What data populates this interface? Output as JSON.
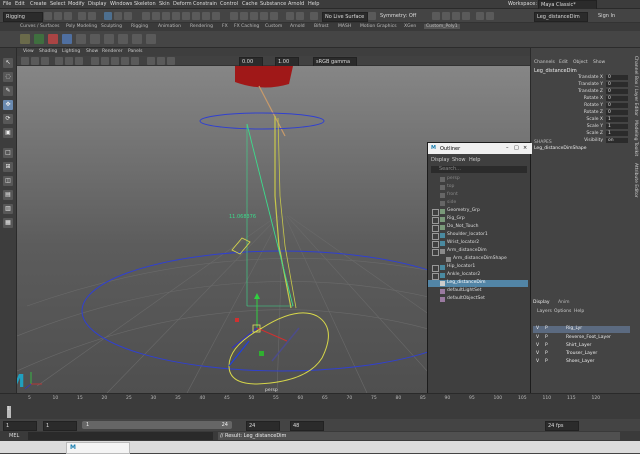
{
  "menubar": {
    "items": [
      "File",
      "Edit",
      "Create",
      "Select",
      "Modify",
      "Display",
      "Windows",
      "Skeleton",
      "Skin",
      "Deform",
      "Constrain",
      "Control",
      "Cache",
      "Substance",
      "Arnold",
      "Help"
    ],
    "workspace_label": "Workspace:",
    "workspace_value": "Maya Classic*"
  },
  "statusline": {
    "mode": "Rigging",
    "no_live_surface": "No Live Surface",
    "symmetry": "Symmetry: Off",
    "search_value": "Leg_distanceDim",
    "user": "Sign In"
  },
  "shelf_tabs": [
    "Curves / Surfaces",
    "Poly Modeling",
    "Sculpting",
    "Rigging",
    "Animation",
    "Rendering",
    "FX",
    "FX Caching",
    "Custom",
    "Arnold",
    "Bifrost",
    "MASH",
    "Motion Graphics",
    "XGen",
    "Custom_Poly1"
  ],
  "viewport": {
    "menus": [
      "View",
      "Shading",
      "Lighting",
      "Show",
      "Renderer",
      "Panels"
    ],
    "field_a": "0.00",
    "field_b": "1.00",
    "colorspace": "sRGB gamma",
    "distance_label": "11.068376",
    "camera_label": "persp"
  },
  "channelbox": {
    "tabs": [
      "Channels",
      "Edit",
      "Object",
      "Show"
    ],
    "object_name": "Leg_distanceDim",
    "attributes": [
      {
        "name": "Translate X",
        "value": "0"
      },
      {
        "name": "Translate Y",
        "value": "0"
      },
      {
        "name": "Translate Z",
        "value": "0"
      },
      {
        "name": "Rotate X",
        "value": "0"
      },
      {
        "name": "Rotate Y",
        "value": "0"
      },
      {
        "name": "Rotate Z",
        "value": "0"
      },
      {
        "name": "Scale X",
        "value": "1"
      },
      {
        "name": "Scale Y",
        "value": "1"
      },
      {
        "name": "Scale Z",
        "value": "1"
      },
      {
        "name": "Visibility",
        "value": "on"
      }
    ],
    "shapes_label": "SHAPES",
    "shape_name": "Leg_distanceDimShape",
    "side_tabs": [
      "Channel Box / Layer Editor",
      "Modeling Toolkit",
      "Attribute Editor"
    ]
  },
  "layer_editor": {
    "tabs": [
      "Display",
      "Anim"
    ],
    "menus": [
      "Layers",
      "Options",
      "Help"
    ],
    "layers": [
      {
        "v": "V",
        "p": "P",
        "name": "Rig_Lyr"
      },
      {
        "v": "V",
        "p": "P",
        "name": "Reverse_Foot_Layer"
      },
      {
        "v": "V",
        "p": "P",
        "name": "Shirt_Layer"
      },
      {
        "v": "V",
        "p": "P",
        "name": "Trouser_Layer"
      },
      {
        "v": "V",
        "p": "P",
        "name": "Shoes_Layer"
      }
    ]
  },
  "outliner": {
    "title": "Outliner",
    "menus": [
      "Display",
      "Show",
      "Help"
    ],
    "search_placeholder": "Search...",
    "rows": [
      {
        "label": "persp",
        "dim": true
      },
      {
        "label": "top",
        "dim": true
      },
      {
        "label": "front",
        "dim": true
      },
      {
        "label": "side",
        "dim": true
      },
      {
        "label": "Geometry_Grp",
        "dim": false
      },
      {
        "label": "Rig_Grp",
        "dim": false
      },
      {
        "label": "Do_Not_Touch",
        "dim": false
      },
      {
        "label": "Shoulder_locator1",
        "dim": false
      },
      {
        "label": "Wrist_locator2",
        "dim": false
      },
      {
        "label": "Arm_distanceDim",
        "dim": false
      },
      {
        "label": "Arm_distanceDimShape",
        "dim": false
      },
      {
        "label": "Hip_locator1",
        "dim": false
      },
      {
        "label": "Ankle_locator2",
        "dim": false
      },
      {
        "label": "Leg_distanceDim",
        "dim": false,
        "selected": true
      },
      {
        "label": "defaultLightSet",
        "dim": false
      },
      {
        "label": "defaultObjectSet",
        "dim": false
      }
    ]
  },
  "timeslider": {
    "ticks": [
      "5",
      "10",
      "15",
      "20",
      "25",
      "30",
      "35",
      "40",
      "45",
      "50",
      "55",
      "60",
      "65",
      "70",
      "75",
      "80",
      "85",
      "90",
      "95",
      "100",
      "105",
      "110",
      "115",
      "120"
    ],
    "current_frame": "1"
  },
  "rangeslider": {
    "start": "1",
    "playback_start": "1",
    "range_start": "1",
    "range_end": "24",
    "playback_end": "24",
    "end": "48",
    "fps": "24 fps"
  },
  "cmdline": {
    "lang": "MEL",
    "result": "// Result: Leg_distanceDim"
  },
  "colors": {
    "accent": "#5285a6",
    "selected_row": "#5285a6",
    "measure": "#3cdc8c",
    "joint": "#c8c84a",
    "circle": "#3040d0"
  }
}
